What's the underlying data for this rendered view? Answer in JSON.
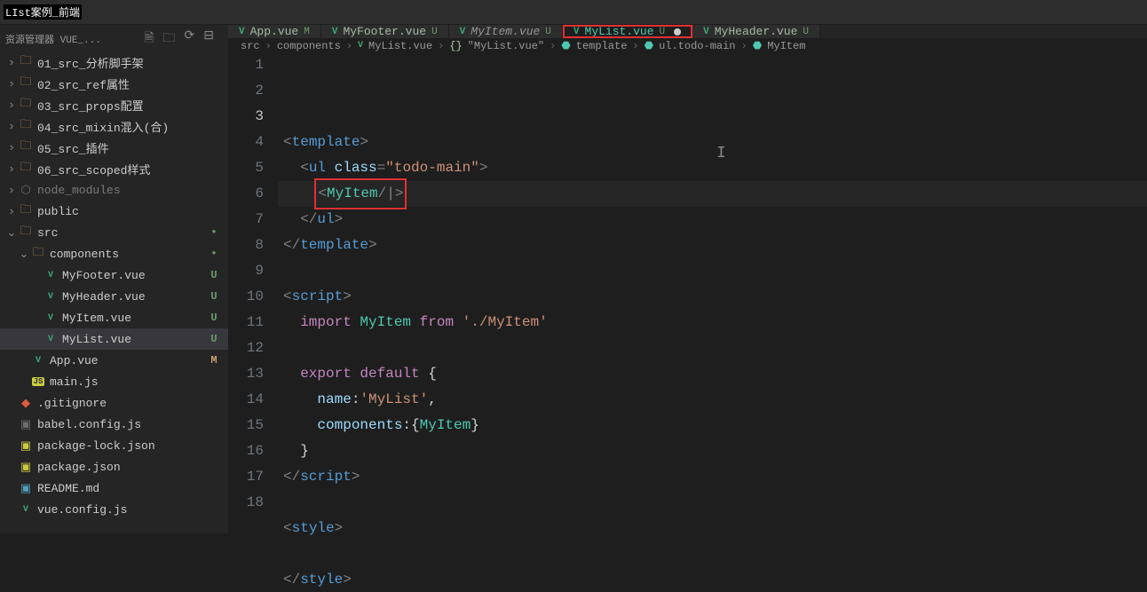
{
  "title_top": {
    "black": "LIst案例_前端",
    "grey": "资源管理器 VUE_..."
  },
  "tabs": [
    {
      "name": "App.vue",
      "status": "M",
      "plain": true,
      "active": false,
      "highlight": false,
      "dirty": false
    },
    {
      "name": "MyFooter.vue",
      "status": "U",
      "plain": true,
      "active": false,
      "highlight": false,
      "dirty": false
    },
    {
      "name": "MyItem.vue",
      "status": "U",
      "plain": false,
      "active": false,
      "highlight": false,
      "dirty": false
    },
    {
      "name": "MyList.vue",
      "status": "U",
      "plain": false,
      "active": true,
      "highlight": true,
      "dirty": true
    },
    {
      "name": "MyHeader.vue",
      "status": "U",
      "plain": true,
      "active": false,
      "highlight": false,
      "dirty": false
    }
  ],
  "breadcrumb": {
    "parts": [
      "src",
      "components",
      "MyList.vue",
      "\"MyList.vue\"",
      "template",
      "ul.todo-main",
      "MyItem"
    ]
  },
  "explorer": [
    {
      "depth": 0,
      "chev": "›",
      "type": "folder",
      "label": "01_src_分析脚手架"
    },
    {
      "depth": 0,
      "chev": "›",
      "type": "folder",
      "label": "02_src_ref属性"
    },
    {
      "depth": 0,
      "chev": "›",
      "type": "folder",
      "label": "03_src_props配置"
    },
    {
      "depth": 0,
      "chev": "›",
      "type": "folder",
      "label": "04_src_mixin混入(合)"
    },
    {
      "depth": 0,
      "chev": "›",
      "type": "folder",
      "label": "05_src_插件"
    },
    {
      "depth": 0,
      "chev": "›",
      "type": "folder",
      "label": "06_src_scoped样式"
    },
    {
      "depth": 0,
      "chev": "›",
      "type": "folder-dim",
      "label": "node_modules",
      "dim": true
    },
    {
      "depth": 0,
      "chev": "›",
      "type": "folder",
      "label": "public"
    },
    {
      "depth": 0,
      "chev": "⌄",
      "type": "folder",
      "label": "src",
      "dot": true
    },
    {
      "depth": 1,
      "chev": "⌄",
      "type": "folder",
      "label": "components",
      "dot": true
    },
    {
      "depth": 2,
      "chev": "",
      "type": "vue",
      "label": "MyFooter.vue",
      "status": "U"
    },
    {
      "depth": 2,
      "chev": "",
      "type": "vue",
      "label": "MyHeader.vue",
      "status": "U"
    },
    {
      "depth": 2,
      "chev": "",
      "type": "vue",
      "label": "MyItem.vue",
      "status": "U"
    },
    {
      "depth": 2,
      "chev": "",
      "type": "vue",
      "label": "MyList.vue",
      "status": "U",
      "selected": true
    },
    {
      "depth": 1,
      "chev": "",
      "type": "vue",
      "label": "App.vue",
      "status": "M"
    },
    {
      "depth": 1,
      "chev": "",
      "type": "js",
      "label": "main.js"
    },
    {
      "depth": 0,
      "chev": "",
      "type": "git",
      "label": ".gitignore"
    },
    {
      "depth": 0,
      "chev": "",
      "type": "cfg",
      "label": "babel.config.js"
    },
    {
      "depth": 0,
      "chev": "",
      "type": "json",
      "label": "package-lock.json"
    },
    {
      "depth": 0,
      "chev": "",
      "type": "json",
      "label": "package.json"
    },
    {
      "depth": 0,
      "chev": "",
      "type": "md",
      "label": "README.md"
    },
    {
      "depth": 0,
      "chev": "",
      "type": "vue",
      "label": "vue.config.js"
    }
  ],
  "code": {
    "lines": [
      {
        "n": 1,
        "html": "<span class='tok-tag'>&lt;</span><span class='tok-el'>template</span><span class='tok-tag'>&gt;</span>"
      },
      {
        "n": 2,
        "html": "  <span class='tok-tag'>&lt;</span><span class='tok-el'>ul</span> <span class='tok-attr'>class</span><span class='tok-tag'>=</span><span class='tok-str'>\"todo-main\"</span><span class='tok-tag'>&gt;</span>"
      },
      {
        "n": 3,
        "html": "    <span class='highlight-box'><span class='tok-tag'>&lt;</span><span class='tok-comp'>MyItem</span><span class='tok-tag'>/</span><span class='cursor-mark'>|</span><span class='tok-tag'>&gt;</span></span>",
        "current": true
      },
      {
        "n": 4,
        "html": "  <span class='tok-tag'>&lt;/</span><span class='tok-el'>ul</span><span class='tok-tag'>&gt;</span>"
      },
      {
        "n": 5,
        "html": "<span class='tok-tag'>&lt;/</span><span class='tok-el'>template</span><span class='tok-tag'>&gt;</span>"
      },
      {
        "n": 6,
        "html": ""
      },
      {
        "n": 7,
        "html": "<span class='tok-tag'>&lt;</span><span class='tok-el'>script</span><span class='tok-tag'>&gt;</span>"
      },
      {
        "n": 8,
        "html": "  <span class='tok-kw'>import</span> <span class='tok-ident'>MyItem</span> <span class='tok-kw'>from</span> <span class='tok-str'>'./MyItem'</span>"
      },
      {
        "n": 9,
        "html": ""
      },
      {
        "n": 10,
        "html": "  <span class='tok-kw'>export</span> <span class='tok-kw'>default</span> {"
      },
      {
        "n": 11,
        "html": "    <span class='tok-name'>name</span>:<span class='tok-str'>'MyList'</span>,"
      },
      {
        "n": 12,
        "html": "    <span class='tok-name'>components</span>:{<span class='tok-ident'>MyItem</span>}"
      },
      {
        "n": 13,
        "html": "  }"
      },
      {
        "n": 14,
        "html": "<span class='tok-tag'>&lt;/</span><span class='tok-el'>script</span><span class='tok-tag'>&gt;</span>"
      },
      {
        "n": 15,
        "html": ""
      },
      {
        "n": 16,
        "html": "<span class='tok-tag'>&lt;</span><span class='tok-el'>style</span><span class='tok-tag'>&gt;</span>"
      },
      {
        "n": 17,
        "html": ""
      },
      {
        "n": 18,
        "html": "<span class='tok-tag'>&lt;/</span><span class='tok-el'>style</span><span class='tok-tag'>&gt;</span>"
      }
    ]
  }
}
